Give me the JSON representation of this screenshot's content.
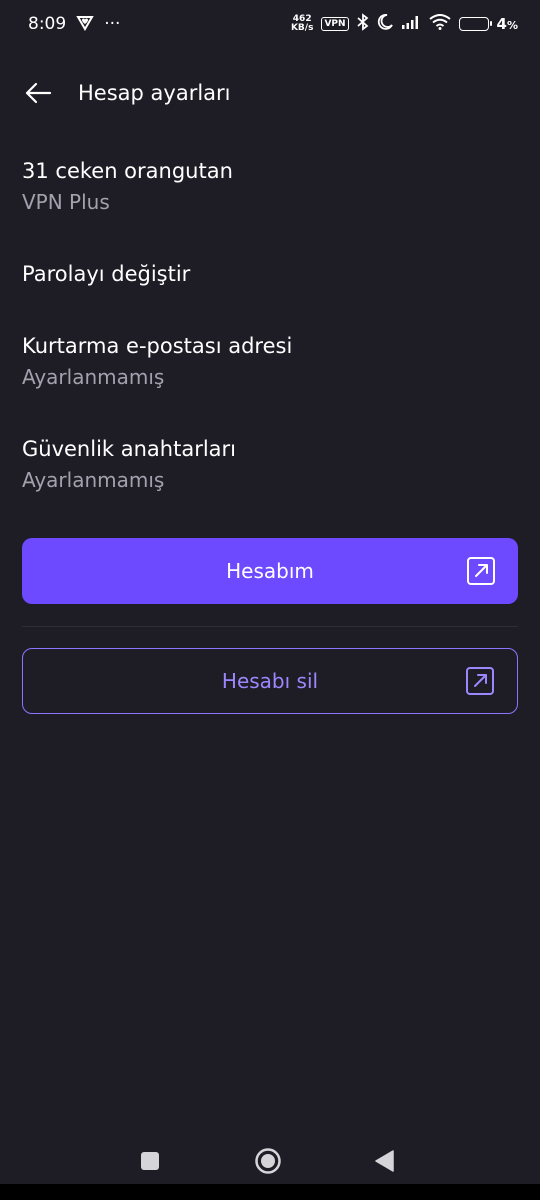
{
  "status_bar": {
    "time": "8:09",
    "dots": "···",
    "net_speed_value": "462",
    "net_speed_unit": "KB/s",
    "vpn_label": "VPN",
    "battery_percent": "4",
    "battery_percent_sign": "%"
  },
  "header": {
    "title": "Hesap ayarları"
  },
  "account": {
    "name": "31 ceken orangutan",
    "plan": "VPN Plus"
  },
  "settings": {
    "change_password": "Parolayı değiştir",
    "recovery_email_title": "Kurtarma e-postası adresi",
    "recovery_email_value": "Ayarlanmamış",
    "security_keys_title": "Güvenlik anahtarları",
    "security_keys_value": "Ayarlanmamış"
  },
  "buttons": {
    "my_account": "Hesabım",
    "delete_account": "Hesabı sil"
  },
  "colors": {
    "background": "#1e1d26",
    "accent": "#6d4aff",
    "accent_text": "#9d87ff",
    "secondary_text": "#a3a1ae"
  },
  "icons": {
    "back": "arrow-left-icon",
    "external_link": "external-link-icon",
    "nav_recents": "square-icon",
    "nav_home": "circle-icon",
    "nav_back": "triangle-back-icon"
  }
}
